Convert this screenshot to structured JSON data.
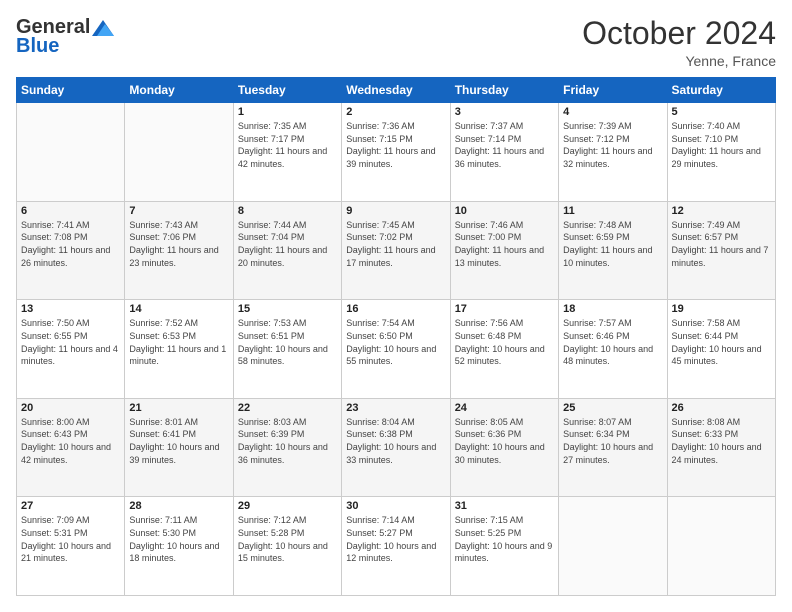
{
  "logo": {
    "general": "General",
    "blue": "Blue"
  },
  "header": {
    "month": "October 2024",
    "location": "Yenne, France"
  },
  "days_of_week": [
    "Sunday",
    "Monday",
    "Tuesday",
    "Wednesday",
    "Thursday",
    "Friday",
    "Saturday"
  ],
  "weeks": [
    [
      {
        "day": "",
        "empty": true
      },
      {
        "day": "",
        "empty": true
      },
      {
        "day": "1",
        "sunrise": "Sunrise: 7:35 AM",
        "sunset": "Sunset: 7:17 PM",
        "daylight": "Daylight: 11 hours and 42 minutes."
      },
      {
        "day": "2",
        "sunrise": "Sunrise: 7:36 AM",
        "sunset": "Sunset: 7:15 PM",
        "daylight": "Daylight: 11 hours and 39 minutes."
      },
      {
        "day": "3",
        "sunrise": "Sunrise: 7:37 AM",
        "sunset": "Sunset: 7:14 PM",
        "daylight": "Daylight: 11 hours and 36 minutes."
      },
      {
        "day": "4",
        "sunrise": "Sunrise: 7:39 AM",
        "sunset": "Sunset: 7:12 PM",
        "daylight": "Daylight: 11 hours and 32 minutes."
      },
      {
        "day": "5",
        "sunrise": "Sunrise: 7:40 AM",
        "sunset": "Sunset: 7:10 PM",
        "daylight": "Daylight: 11 hours and 29 minutes."
      }
    ],
    [
      {
        "day": "6",
        "sunrise": "Sunrise: 7:41 AM",
        "sunset": "Sunset: 7:08 PM",
        "daylight": "Daylight: 11 hours and 26 minutes."
      },
      {
        "day": "7",
        "sunrise": "Sunrise: 7:43 AM",
        "sunset": "Sunset: 7:06 PM",
        "daylight": "Daylight: 11 hours and 23 minutes."
      },
      {
        "day": "8",
        "sunrise": "Sunrise: 7:44 AM",
        "sunset": "Sunset: 7:04 PM",
        "daylight": "Daylight: 11 hours and 20 minutes."
      },
      {
        "day": "9",
        "sunrise": "Sunrise: 7:45 AM",
        "sunset": "Sunset: 7:02 PM",
        "daylight": "Daylight: 11 hours and 17 minutes."
      },
      {
        "day": "10",
        "sunrise": "Sunrise: 7:46 AM",
        "sunset": "Sunset: 7:00 PM",
        "daylight": "Daylight: 11 hours and 13 minutes."
      },
      {
        "day": "11",
        "sunrise": "Sunrise: 7:48 AM",
        "sunset": "Sunset: 6:59 PM",
        "daylight": "Daylight: 11 hours and 10 minutes."
      },
      {
        "day": "12",
        "sunrise": "Sunrise: 7:49 AM",
        "sunset": "Sunset: 6:57 PM",
        "daylight": "Daylight: 11 hours and 7 minutes."
      }
    ],
    [
      {
        "day": "13",
        "sunrise": "Sunrise: 7:50 AM",
        "sunset": "Sunset: 6:55 PM",
        "daylight": "Daylight: 11 hours and 4 minutes."
      },
      {
        "day": "14",
        "sunrise": "Sunrise: 7:52 AM",
        "sunset": "Sunset: 6:53 PM",
        "daylight": "Daylight: 11 hours and 1 minute."
      },
      {
        "day": "15",
        "sunrise": "Sunrise: 7:53 AM",
        "sunset": "Sunset: 6:51 PM",
        "daylight": "Daylight: 10 hours and 58 minutes."
      },
      {
        "day": "16",
        "sunrise": "Sunrise: 7:54 AM",
        "sunset": "Sunset: 6:50 PM",
        "daylight": "Daylight: 10 hours and 55 minutes."
      },
      {
        "day": "17",
        "sunrise": "Sunrise: 7:56 AM",
        "sunset": "Sunset: 6:48 PM",
        "daylight": "Daylight: 10 hours and 52 minutes."
      },
      {
        "day": "18",
        "sunrise": "Sunrise: 7:57 AM",
        "sunset": "Sunset: 6:46 PM",
        "daylight": "Daylight: 10 hours and 48 minutes."
      },
      {
        "day": "19",
        "sunrise": "Sunrise: 7:58 AM",
        "sunset": "Sunset: 6:44 PM",
        "daylight": "Daylight: 10 hours and 45 minutes."
      }
    ],
    [
      {
        "day": "20",
        "sunrise": "Sunrise: 8:00 AM",
        "sunset": "Sunset: 6:43 PM",
        "daylight": "Daylight: 10 hours and 42 minutes."
      },
      {
        "day": "21",
        "sunrise": "Sunrise: 8:01 AM",
        "sunset": "Sunset: 6:41 PM",
        "daylight": "Daylight: 10 hours and 39 minutes."
      },
      {
        "day": "22",
        "sunrise": "Sunrise: 8:03 AM",
        "sunset": "Sunset: 6:39 PM",
        "daylight": "Daylight: 10 hours and 36 minutes."
      },
      {
        "day": "23",
        "sunrise": "Sunrise: 8:04 AM",
        "sunset": "Sunset: 6:38 PM",
        "daylight": "Daylight: 10 hours and 33 minutes."
      },
      {
        "day": "24",
        "sunrise": "Sunrise: 8:05 AM",
        "sunset": "Sunset: 6:36 PM",
        "daylight": "Daylight: 10 hours and 30 minutes."
      },
      {
        "day": "25",
        "sunrise": "Sunrise: 8:07 AM",
        "sunset": "Sunset: 6:34 PM",
        "daylight": "Daylight: 10 hours and 27 minutes."
      },
      {
        "day": "26",
        "sunrise": "Sunrise: 8:08 AM",
        "sunset": "Sunset: 6:33 PM",
        "daylight": "Daylight: 10 hours and 24 minutes."
      }
    ],
    [
      {
        "day": "27",
        "sunrise": "Sunrise: 7:09 AM",
        "sunset": "Sunset: 5:31 PM",
        "daylight": "Daylight: 10 hours and 21 minutes."
      },
      {
        "day": "28",
        "sunrise": "Sunrise: 7:11 AM",
        "sunset": "Sunset: 5:30 PM",
        "daylight": "Daylight: 10 hours and 18 minutes."
      },
      {
        "day": "29",
        "sunrise": "Sunrise: 7:12 AM",
        "sunset": "Sunset: 5:28 PM",
        "daylight": "Daylight: 10 hours and 15 minutes."
      },
      {
        "day": "30",
        "sunrise": "Sunrise: 7:14 AM",
        "sunset": "Sunset: 5:27 PM",
        "daylight": "Daylight: 10 hours and 12 minutes."
      },
      {
        "day": "31",
        "sunrise": "Sunrise: 7:15 AM",
        "sunset": "Sunset: 5:25 PM",
        "daylight": "Daylight: 10 hours and 9 minutes."
      },
      {
        "day": "",
        "empty": true
      },
      {
        "day": "",
        "empty": true
      }
    ]
  ]
}
